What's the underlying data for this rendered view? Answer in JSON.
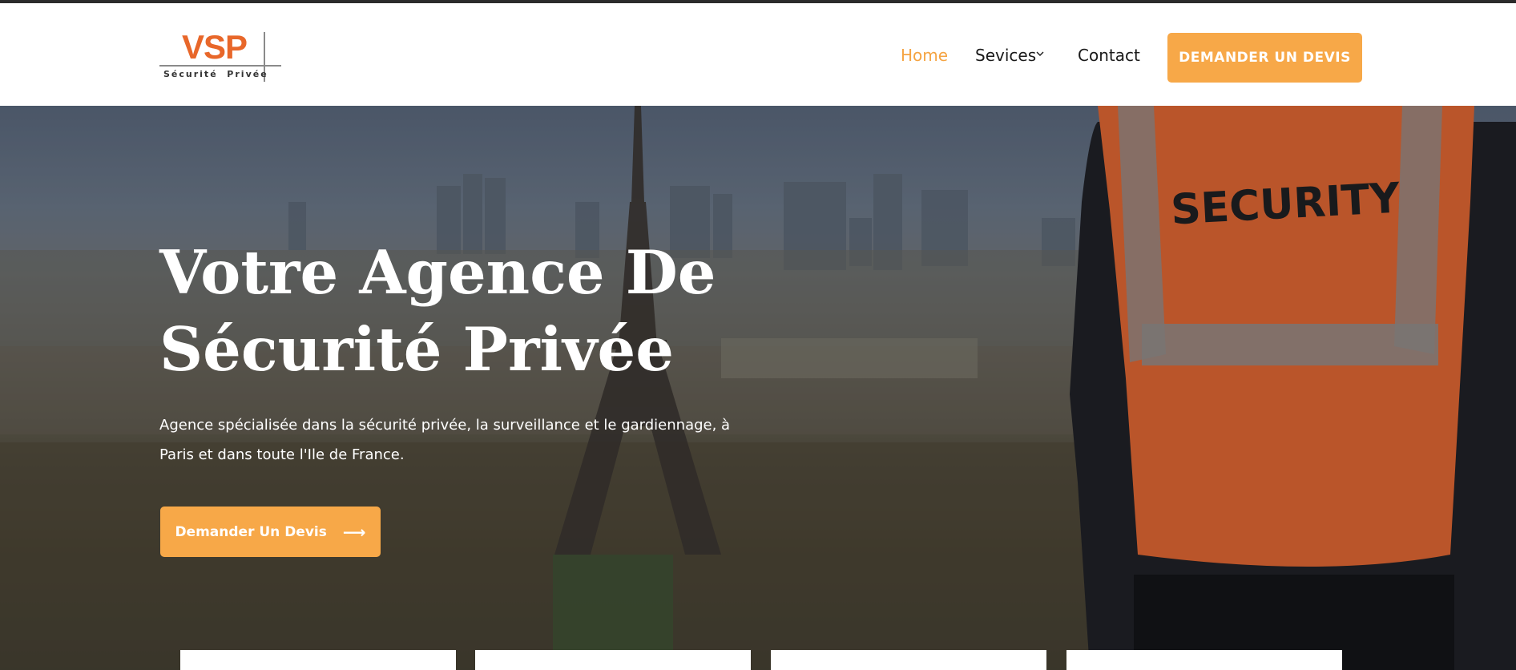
{
  "brand": {
    "logo_text": "VSP",
    "logo_subtitle": "Sécurité  Privée"
  },
  "nav": {
    "items": [
      {
        "label": "Home",
        "active": true
      },
      {
        "label": "Sevices",
        "has_dropdown": true
      },
      {
        "label": "Contact"
      }
    ],
    "cta_label": "DEMANDER UN DEVIS"
  },
  "hero": {
    "title_line1": "Votre Agence De",
    "title_line2": "Sécurité Privée",
    "description": "Agence spécialisée dans la sécurité privée, la surveillance et le gardiennage, à Paris et dans toute l'Ile de France.",
    "cta_label": "Demander Un Devis",
    "cta_icon": "arrow-right-icon",
    "vest_text": "SECURITY"
  },
  "colors": {
    "accent": "#f7a848",
    "nav_active": "#f5a443",
    "logo_orange": "#e8672a",
    "vest_orange": "#f26a2e"
  }
}
